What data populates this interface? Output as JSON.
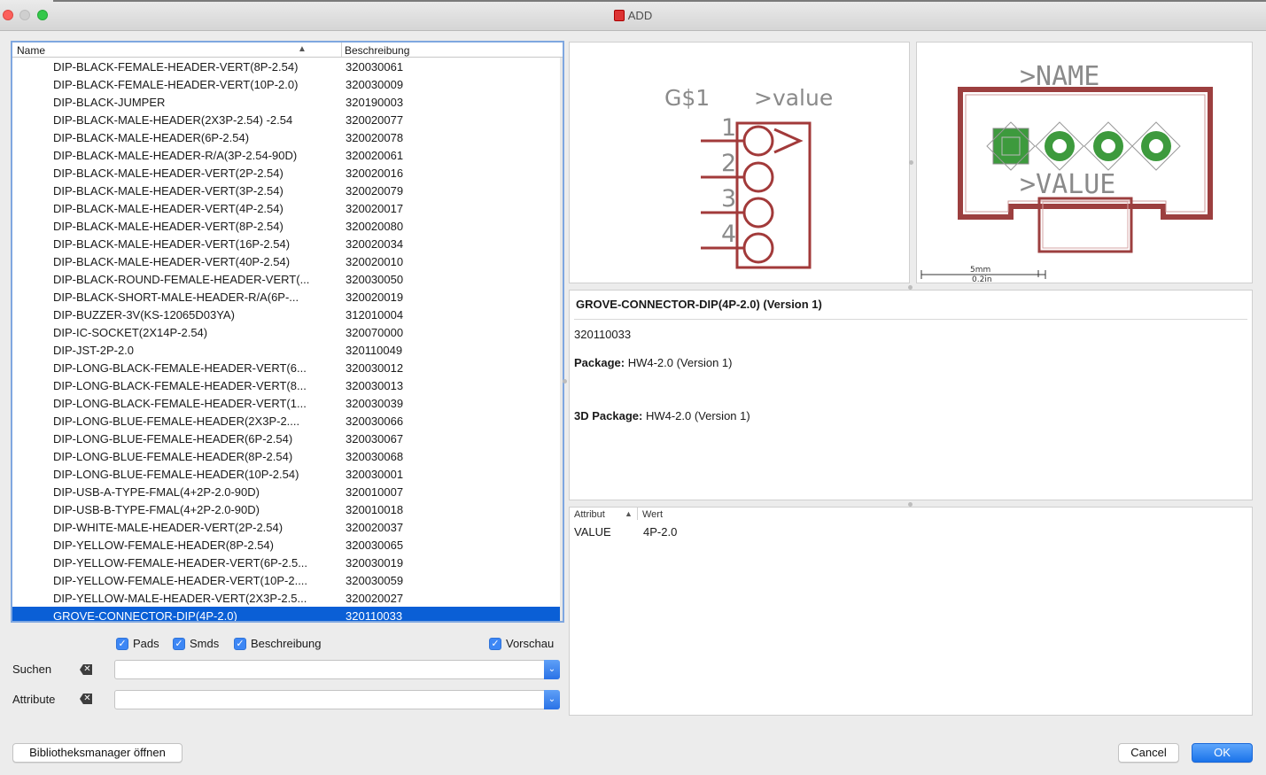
{
  "window": {
    "title": "ADD"
  },
  "list": {
    "col_name": "Name",
    "col_desc": "Beschreibung",
    "rows": [
      {
        "name": "DIP-BLACK-FEMALE-HEADER-VERT(8P-2.54)",
        "desc": "320030061"
      },
      {
        "name": "DIP-BLACK-FEMALE-HEADER-VERT(10P-2.0)",
        "desc": "320030009"
      },
      {
        "name": "DIP-BLACK-JUMPER",
        "desc": "320190003"
      },
      {
        "name": "DIP-BLACK-MALE-HEADER(2X3P-2.54)  -2.54",
        "desc": "320020077"
      },
      {
        "name": "DIP-BLACK-MALE-HEADER(6P-2.54)",
        "desc": "320020078"
      },
      {
        "name": "DIP-BLACK-MALE-HEADER-R/A(3P-2.54-90D)",
        "desc": "320020061"
      },
      {
        "name": "DIP-BLACK-MALE-HEADER-VERT(2P-2.54)",
        "desc": "320020016"
      },
      {
        "name": "DIP-BLACK-MALE-HEADER-VERT(3P-2.54)",
        "desc": "320020079"
      },
      {
        "name": "DIP-BLACK-MALE-HEADER-VERT(4P-2.54)",
        "desc": "320020017"
      },
      {
        "name": "DIP-BLACK-MALE-HEADER-VERT(8P-2.54)",
        "desc": "320020080"
      },
      {
        "name": "DIP-BLACK-MALE-HEADER-VERT(16P-2.54)",
        "desc": "320020034"
      },
      {
        "name": "DIP-BLACK-MALE-HEADER-VERT(40P-2.54)",
        "desc": "320020010"
      },
      {
        "name": "DIP-BLACK-ROUND-FEMALE-HEADER-VERT(...",
        "desc": "320030050"
      },
      {
        "name": "DIP-BLACK-SHORT-MALE-HEADER-R/A(6P-...",
        "desc": "320020019"
      },
      {
        "name": "DIP-BUZZER-3V(KS-12065D03YA)",
        "desc": "312010004"
      },
      {
        "name": "DIP-IC-SOCKET(2X14P-2.54)",
        "desc": "320070000"
      },
      {
        "name": "DIP-JST-2P-2.0",
        "desc": "320110049"
      },
      {
        "name": "DIP-LONG-BLACK-FEMALE-HEADER-VERT(6...",
        "desc": "320030012"
      },
      {
        "name": "DIP-LONG-BLACK-FEMALE-HEADER-VERT(8...",
        "desc": "320030013"
      },
      {
        "name": "DIP-LONG-BLACK-FEMALE-HEADER-VERT(1...",
        "desc": "320030039"
      },
      {
        "name": "DIP-LONG-BLUE-FEMALE-HEADER(2X3P-2....",
        "desc": "320030066"
      },
      {
        "name": "DIP-LONG-BLUE-FEMALE-HEADER(6P-2.54)",
        "desc": "320030067"
      },
      {
        "name": "DIP-LONG-BLUE-FEMALE-HEADER(8P-2.54)",
        "desc": "320030068"
      },
      {
        "name": "DIP-LONG-BLUE-FEMALE-HEADER(10P-2.54)",
        "desc": "320030001"
      },
      {
        "name": "DIP-USB-A-TYPE-FMAL(4+2P-2.0-90D)",
        "desc": "320010007"
      },
      {
        "name": "DIP-USB-B-TYPE-FMAL(4+2P-2.0-90D)",
        "desc": "320010018"
      },
      {
        "name": "DIP-WHITE-MALE-HEADER-VERT(2P-2.54)",
        "desc": "320020037"
      },
      {
        "name": "DIP-YELLOW-FEMALE-HEADER(8P-2.54)",
        "desc": "320030065"
      },
      {
        "name": "DIP-YELLOW-FEMALE-HEADER-VERT(6P-2.5...",
        "desc": "320030019"
      },
      {
        "name": "DIP-YELLOW-FEMALE-HEADER-VERT(10P-2....",
        "desc": "320030059"
      },
      {
        "name": "DIP-YELLOW-MALE-HEADER-VERT(2X3P-2.5...",
        "desc": "320020027"
      },
      {
        "name": "GROVE-CONNECTOR-DIP(4P-2.0)",
        "desc": "320110033",
        "selected": true
      }
    ]
  },
  "filters": {
    "pads": "Pads",
    "smds": "Smds",
    "beschreibung": "Beschreibung",
    "vorschau": "Vorschau",
    "suchen_label": "Suchen",
    "attribute_label": "Attribute",
    "suchen_value": "",
    "attribute_value": ""
  },
  "symbol": {
    "name": "G$1",
    "value": ">value",
    "pins": [
      "1",
      "2",
      "3",
      "4"
    ]
  },
  "package": {
    "name_label": ">NAME",
    "value_label": ">VALUE",
    "scale_mm": "5mm",
    "scale_in": "0.2in"
  },
  "info": {
    "title": "GROVE-CONNECTOR-DIP(4P-2.0) (Version 1)",
    "description": "320110033",
    "package_label": "Package:",
    "package_value": " HW4-2.0 (Version 1)",
    "package3d_label": "3D Package:",
    "package3d_value": " HW4-2.0 (Version 1)"
  },
  "attributes": {
    "col_attr": "Attribut",
    "col_wert": "Wert",
    "rows": [
      {
        "attr": "VALUE",
        "wert": "4P-2.0"
      }
    ]
  },
  "buttons": {
    "library_manager": "Bibliotheksmanager öffnen",
    "cancel": "Cancel",
    "ok": "OK"
  },
  "colors": {
    "selection": "#0a5fd6",
    "schematic": "#a23a3a",
    "pad": "#3d9a3d"
  }
}
